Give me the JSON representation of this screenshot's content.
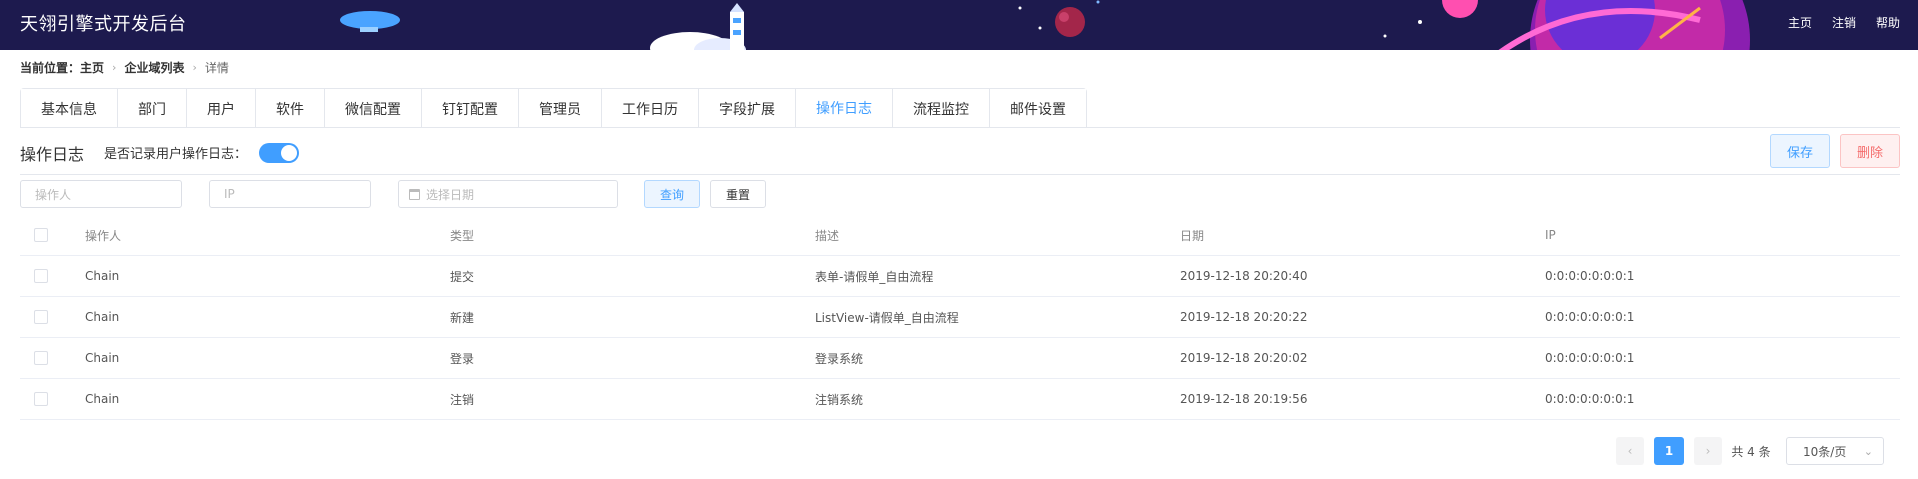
{
  "header": {
    "title": "天翎引擎式开发后台",
    "nav": [
      "主页",
      "注销",
      "帮助"
    ]
  },
  "breadcrumb": {
    "prefix": "当前位置：",
    "items": [
      "主页",
      "企业域列表",
      "详情"
    ]
  },
  "tabs": [
    {
      "label": "基本信息"
    },
    {
      "label": "部门"
    },
    {
      "label": "用户"
    },
    {
      "label": "软件"
    },
    {
      "label": "微信配置"
    },
    {
      "label": "钉钉配置"
    },
    {
      "label": "管理员"
    },
    {
      "label": "工作日历"
    },
    {
      "label": "字段扩展"
    },
    {
      "label": "操作日志",
      "active": true
    },
    {
      "label": "流程监控"
    },
    {
      "label": "邮件设置"
    }
  ],
  "section": {
    "title": "操作日志",
    "toggle_label": "是否记录用户操作日志：",
    "toggle_on": true
  },
  "actions": {
    "save": "保存",
    "delete": "删除"
  },
  "filters": {
    "operator_placeholder": "操作人",
    "ip_placeholder": "IP",
    "date_placeholder": "选择日期",
    "query": "查询",
    "reset": "重置"
  },
  "table": {
    "columns": [
      "操作人",
      "类型",
      "描述",
      "日期",
      "IP"
    ],
    "rows": [
      {
        "operator": "Chain",
        "type": "提交",
        "desc": "表单-请假单_自由流程",
        "date": "2019-12-18 20:20:40",
        "ip": "0:0:0:0:0:0:0:1"
      },
      {
        "operator": "Chain",
        "type": "新建",
        "desc": "ListView-请假单_自由流程",
        "date": "2019-12-18 20:20:22",
        "ip": "0:0:0:0:0:0:0:1"
      },
      {
        "operator": "Chain",
        "type": "登录",
        "desc": "登录系统",
        "date": "2019-12-18 20:20:02",
        "ip": "0:0:0:0:0:0:0:1"
      },
      {
        "operator": "Chain",
        "type": "注销",
        "desc": "注销系统",
        "date": "2019-12-18 20:19:56",
        "ip": "0:0:0:0:0:0:0:1"
      }
    ]
  },
  "pagination": {
    "prev_icon": "‹",
    "current": "1",
    "next_icon": "›",
    "total": "共 4 条",
    "page_size": "10条/页"
  },
  "colors": {
    "header_bg": "#1d1a4e",
    "accent": "#409eff",
    "danger": "#f56c6c"
  }
}
